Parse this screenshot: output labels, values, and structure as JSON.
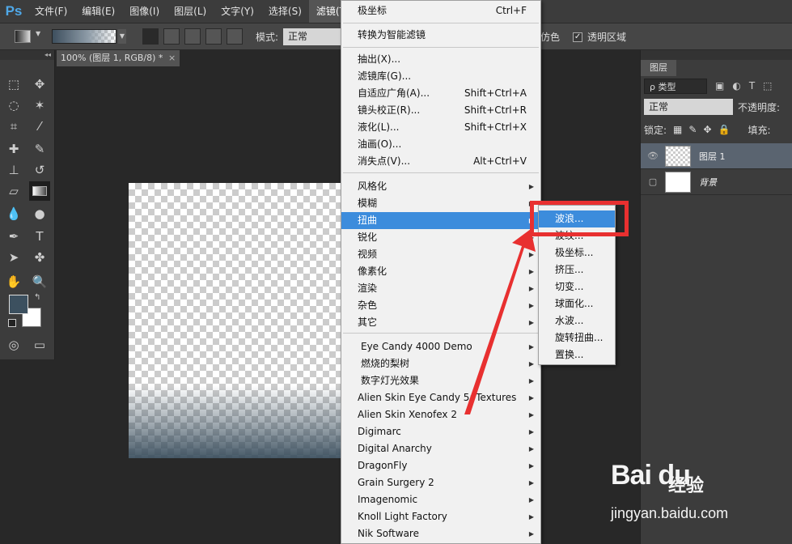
{
  "app": {
    "logo": "Ps"
  },
  "menubar": [
    {
      "label": "文件(F)"
    },
    {
      "label": "编辑(E)"
    },
    {
      "label": "图像(I)"
    },
    {
      "label": "图层(L)"
    },
    {
      "label": "文字(Y)"
    },
    {
      "label": "选择(S)"
    },
    {
      "label": "滤镜(T)"
    }
  ],
  "options": {
    "mode_label": "模式:",
    "mode_value": "正常",
    "dither_label": "仿色",
    "transparency_label": "透明区域",
    "transparency_checked": true
  },
  "document": {
    "tab_title": "100% (图层 1, RGB/8) *",
    "close": "×"
  },
  "colors": {
    "foreground": "#3c505f",
    "background": "#ffffff"
  },
  "filter_menu": {
    "top": [
      {
        "label": "极坐标",
        "shortcut": "Ctrl+F"
      }
    ],
    "smart": {
      "label": "转换为智能滤镜"
    },
    "main": [
      {
        "label": "抽出(X)...",
        "shortcut": ""
      },
      {
        "label": "滤镜库(G)...",
        "shortcut": ""
      },
      {
        "label": "自适应广角(A)...",
        "shortcut": "Shift+Ctrl+A"
      },
      {
        "label": "镜头校正(R)...",
        "shortcut": "Shift+Ctrl+R"
      },
      {
        "label": "液化(L)...",
        "shortcut": "Shift+Ctrl+X"
      },
      {
        "label": "油画(O)...",
        "shortcut": ""
      },
      {
        "label": "消失点(V)...",
        "shortcut": "Alt+Ctrl+V"
      }
    ],
    "groups": [
      {
        "label": "风格化"
      },
      {
        "label": "模糊"
      },
      {
        "label": "扭曲",
        "highlighted": true
      },
      {
        "label": "锐化"
      },
      {
        "label": "视频"
      },
      {
        "label": "像素化"
      },
      {
        "label": "渲染"
      },
      {
        "label": "杂色"
      },
      {
        "label": "其它"
      }
    ],
    "plugins": [
      {
        "label": "Eye Candy 4000  Demo"
      },
      {
        "label": "燃烧的梨树"
      },
      {
        "label": "数字灯光效果"
      },
      {
        "label": "Alien Skin Eye Candy 5: Textures"
      },
      {
        "label": "Alien Skin Xenofex 2"
      },
      {
        "label": "Digimarc"
      },
      {
        "label": "Digital Anarchy"
      },
      {
        "label": "DragonFly"
      },
      {
        "label": "Grain Surgery 2"
      },
      {
        "label": "Imagenomic"
      },
      {
        "label": "Knoll Light Factory"
      },
      {
        "label": "Nik Software"
      }
    ]
  },
  "distort_submenu": [
    {
      "label": "波浪...",
      "highlighted": true
    },
    {
      "label": "波纹..."
    },
    {
      "label": "极坐标..."
    },
    {
      "label": "挤压..."
    },
    {
      "label": "切变..."
    },
    {
      "label": "球面化..."
    },
    {
      "label": "水波..."
    },
    {
      "label": "旋转扭曲..."
    },
    {
      "label": "置换..."
    }
  ],
  "layers_panel": {
    "tab": "图层",
    "filter_kind": "ρ 类型",
    "blend_mode": "正常",
    "opacity_label": "不透明度:",
    "lock_label": "锁定:",
    "fill_label": "填充:",
    "layers": [
      {
        "name": "图层 1",
        "selected": true,
        "visible": true
      },
      {
        "name": "背景",
        "selected": false,
        "visible": false
      }
    ]
  },
  "watermark": {
    "logo": "Bai du",
    "sub": "经验",
    "url": "jingyan.baidu.com"
  }
}
